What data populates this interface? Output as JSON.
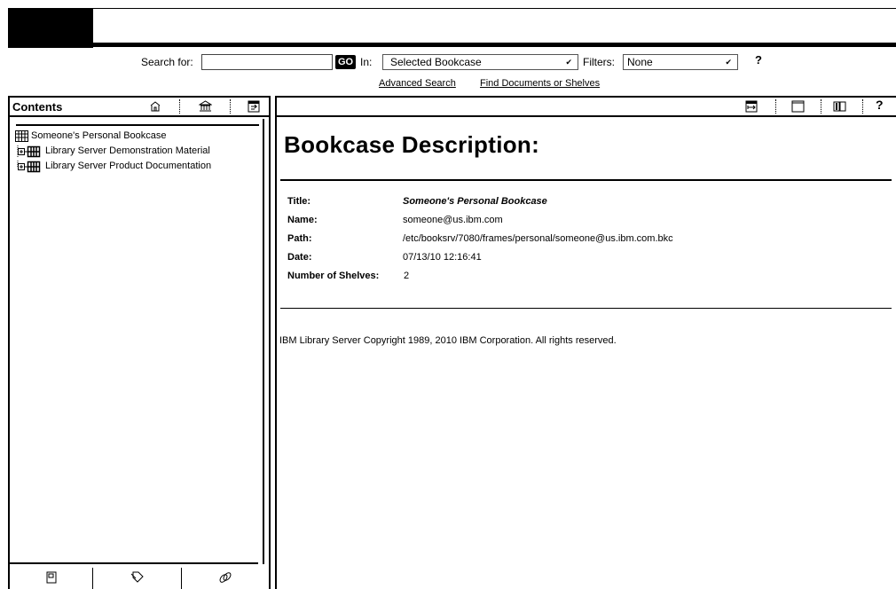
{
  "search": {
    "label": "Search for:",
    "value": "",
    "go_label": "GO",
    "in_label": "In:",
    "scope_selected": "Selected Bookcase",
    "filters_label": "Filters:",
    "filters_selected": "None",
    "help_label": "?"
  },
  "links": {
    "advanced_search": "Advanced Search",
    "find_documents": "Find Documents or Shelves"
  },
  "left_pane": {
    "title": "Contents",
    "header_icons": [
      "home-icon",
      "library-icon",
      "sync-toc-icon"
    ],
    "tree": {
      "root": "Someone's Personal Bookcase",
      "children": [
        "Library Server Demonstration Material",
        "Library Server Product Documentation"
      ]
    },
    "tabs": [
      "contents-tab-icon",
      "bookmarks-tab-icon",
      "links-tab-icon"
    ]
  },
  "right_pane": {
    "header_icons": [
      "expand-frame-icon",
      "single-frame-icon",
      "book-icon",
      "help-icon"
    ],
    "help_label": "?",
    "title": "Bookcase Description:",
    "details": [
      {
        "key": "Title:",
        "value": "Someone's Personal Bookcase"
      },
      {
        "key": "Name:",
        "value": "someone@us.ibm.com"
      },
      {
        "key": "Path:",
        "value": "/etc/booksrv/7080/frames/personal/someone@us.ibm.com.bkc"
      },
      {
        "key": "Date:",
        "value": "07/13/10 12:16:41"
      },
      {
        "key": "Number of Shelves:",
        "value": "2"
      }
    ],
    "copyright": "IBM Library Server Copyright 1989, 2010 IBM Corporation. All rights reserved."
  }
}
